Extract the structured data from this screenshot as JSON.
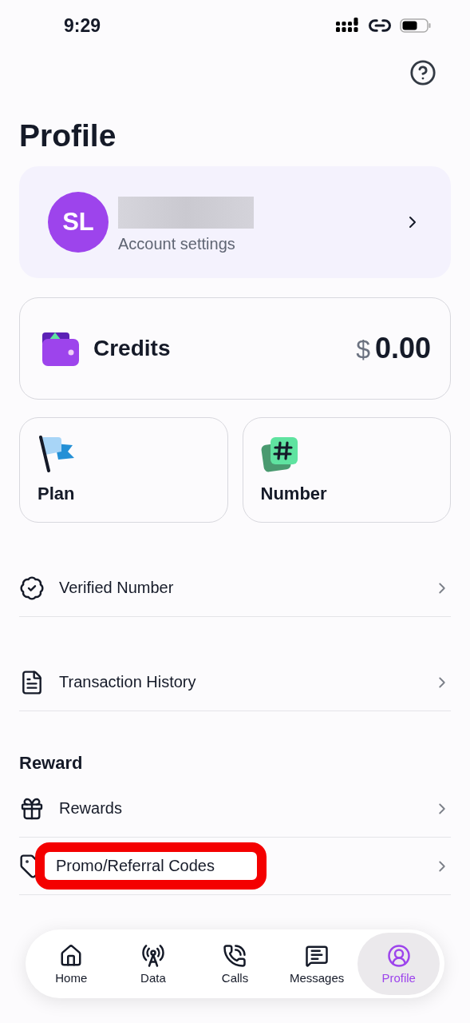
{
  "status_bar": {
    "time": "9:29"
  },
  "title": "Profile",
  "account": {
    "initials": "SL",
    "subtitle": "Account settings",
    "name_redacted": true
  },
  "credits": {
    "label": "Credits",
    "currency": "$",
    "amount": "0.00"
  },
  "tiles": [
    {
      "kind": "plan",
      "label": "Plan"
    },
    {
      "kind": "number",
      "label": "Number"
    }
  ],
  "menu": [
    {
      "kind": "verified",
      "label": "Verified Number",
      "highlighted": false
    },
    {
      "kind": "history",
      "label": "Transaction History",
      "highlighted": false
    }
  ],
  "reward_section": {
    "title": "Reward",
    "items": [
      {
        "kind": "gift",
        "label": "Rewards",
        "highlighted": false
      },
      {
        "kind": "tag",
        "label": "Promo/Referral Codes",
        "highlighted": true
      }
    ]
  },
  "nav": [
    {
      "kind": "home",
      "label": "Home",
      "selected": false
    },
    {
      "kind": "data",
      "label": "Data",
      "selected": false
    },
    {
      "kind": "calls",
      "label": "Calls",
      "selected": false
    },
    {
      "kind": "messages",
      "label": "Messages",
      "selected": false
    },
    {
      "kind": "profile",
      "label": "Profile",
      "selected": true
    }
  ]
}
